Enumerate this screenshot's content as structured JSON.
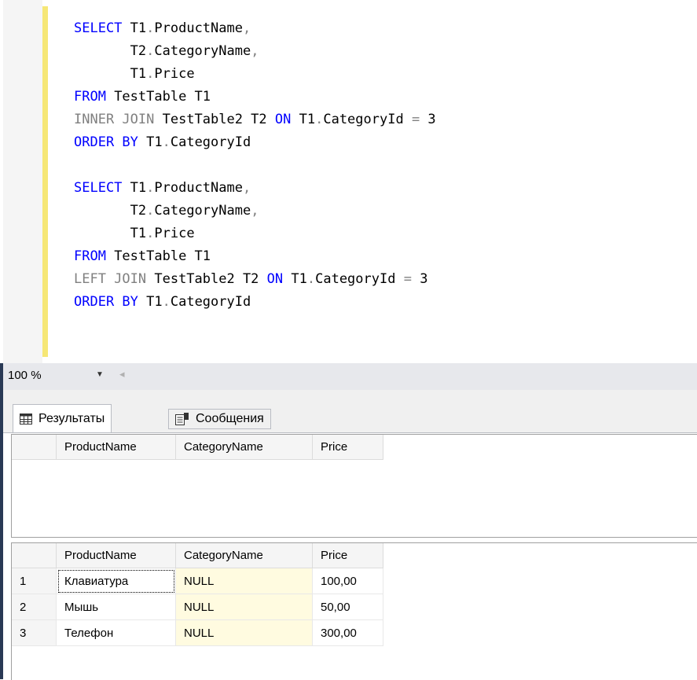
{
  "editor": {
    "lines": [
      {
        "parts": [
          {
            "t": "SELECT",
            "c": "kw"
          },
          {
            "t": " T1",
            "c": ""
          },
          {
            "t": ".",
            "c": "op"
          },
          {
            "t": "ProductName",
            "c": ""
          },
          {
            "t": ",",
            "c": "op"
          }
        ]
      },
      {
        "parts": [
          {
            "t": "       T2",
            "c": ""
          },
          {
            "t": ".",
            "c": "op"
          },
          {
            "t": "CategoryName",
            "c": ""
          },
          {
            "t": ",",
            "c": "op"
          }
        ]
      },
      {
        "parts": [
          {
            "t": "       T1",
            "c": ""
          },
          {
            "t": ".",
            "c": "op"
          },
          {
            "t": "Price",
            "c": ""
          }
        ]
      },
      {
        "parts": [
          {
            "t": "FROM",
            "c": "kw"
          },
          {
            "t": " TestTable T1",
            "c": ""
          }
        ]
      },
      {
        "parts": [
          {
            "t": "INNER JOIN",
            "c": "kw2"
          },
          {
            "t": " TestTable2 T2 ",
            "c": ""
          },
          {
            "t": "ON",
            "c": "kw"
          },
          {
            "t": " T1",
            "c": ""
          },
          {
            "t": ".",
            "c": "op"
          },
          {
            "t": "CategoryId ",
            "c": ""
          },
          {
            "t": "=",
            "c": "op"
          },
          {
            "t": " 3",
            "c": ""
          }
        ]
      },
      {
        "parts": [
          {
            "t": "ORDER BY",
            "c": "kw"
          },
          {
            "t": " T1",
            "c": ""
          },
          {
            "t": ".",
            "c": "op"
          },
          {
            "t": "CategoryId",
            "c": ""
          }
        ]
      },
      {
        "parts": [
          {
            "t": "",
            "c": ""
          }
        ]
      },
      {
        "parts": [
          {
            "t": "SELECT",
            "c": "kw"
          },
          {
            "t": " T1",
            "c": ""
          },
          {
            "t": ".",
            "c": "op"
          },
          {
            "t": "ProductName",
            "c": ""
          },
          {
            "t": ",",
            "c": "op"
          }
        ]
      },
      {
        "parts": [
          {
            "t": "       T2",
            "c": ""
          },
          {
            "t": ".",
            "c": "op"
          },
          {
            "t": "CategoryName",
            "c": ""
          },
          {
            "t": ",",
            "c": "op"
          }
        ]
      },
      {
        "parts": [
          {
            "t": "       T1",
            "c": ""
          },
          {
            "t": ".",
            "c": "op"
          },
          {
            "t": "Price",
            "c": ""
          }
        ]
      },
      {
        "parts": [
          {
            "t": "FROM",
            "c": "kw"
          },
          {
            "t": " TestTable T1",
            "c": ""
          }
        ]
      },
      {
        "parts": [
          {
            "t": "LEFT JOIN",
            "c": "kw2"
          },
          {
            "t": " TestTable2 T2 ",
            "c": ""
          },
          {
            "t": "ON",
            "c": "kw"
          },
          {
            "t": " T1",
            "c": ""
          },
          {
            "t": ".",
            "c": "op"
          },
          {
            "t": "CategoryId ",
            "c": ""
          },
          {
            "t": "=",
            "c": "op"
          },
          {
            "t": " 3",
            "c": ""
          }
        ]
      },
      {
        "parts": [
          {
            "t": "ORDER BY",
            "c": "kw"
          },
          {
            "t": " T1",
            "c": ""
          },
          {
            "t": ".",
            "c": "op"
          },
          {
            "t": "CategoryId",
            "c": ""
          }
        ]
      }
    ]
  },
  "zoom": {
    "value": "100 %"
  },
  "tabs": {
    "results_label": "Результаты",
    "messages_label": "Сообщения"
  },
  "grid1": {
    "columns": [
      "ProductName",
      "CategoryName",
      "Price"
    ],
    "rows": []
  },
  "grid2": {
    "columns": [
      "ProductName",
      "CategoryName",
      "Price"
    ],
    "rows": [
      {
        "n": "1",
        "cells": [
          "Клавиатура",
          "NULL",
          "100,00"
        ]
      },
      {
        "n": "2",
        "cells": [
          "Мышь",
          "NULL",
          "50,00"
        ]
      },
      {
        "n": "3",
        "cells": [
          "Телефон",
          "NULL",
          "300,00"
        ]
      }
    ]
  },
  "colors": {
    "keyword": "#0000ff",
    "join_keyword": "#808080",
    "null_cell": "#fffbe0",
    "change_bar": "#f6e776"
  }
}
